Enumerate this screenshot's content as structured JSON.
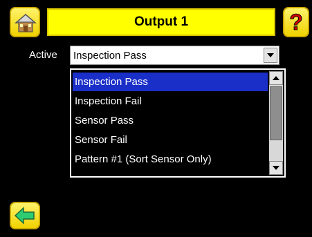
{
  "header": {
    "title": "Output 1",
    "home_icon": "home-icon",
    "help_icon": "help-icon",
    "help_glyph": "?"
  },
  "field": {
    "label": "Active",
    "value": "Inspection Pass"
  },
  "dropdown": {
    "options": [
      "Inspection Pass",
      "Inspection Fail",
      "Sensor Pass",
      "Sensor Fail",
      "Pattern #1 (Sort Sensor Only)"
    ],
    "selected_index": 0
  },
  "footer": {
    "back_icon": "back-arrow-icon"
  },
  "colors": {
    "title_bar": "#ffff00",
    "selection": "#1a2fc8",
    "background": "#000000"
  }
}
